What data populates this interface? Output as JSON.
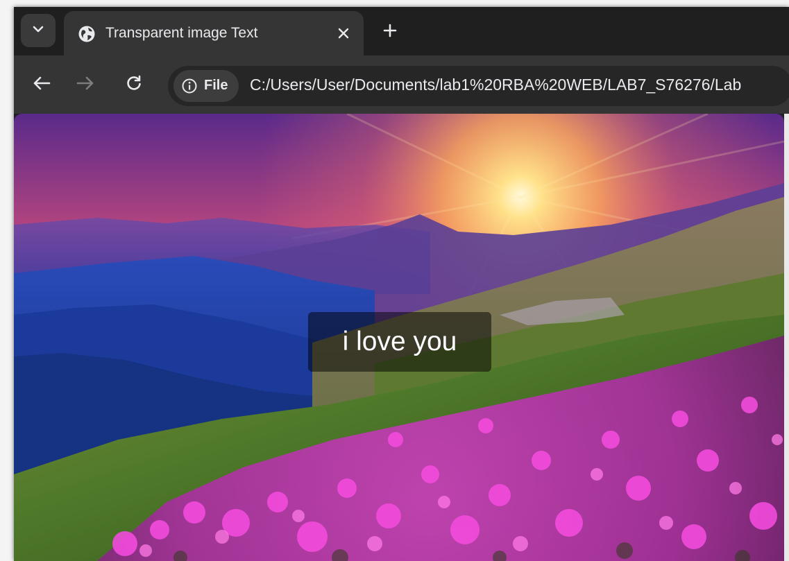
{
  "browser": {
    "tab": {
      "title": "Transparent image Text",
      "favicon": "globe-icon"
    },
    "toolbar": {
      "site_chip_label": "File",
      "url": "C:/Users/User/Documents/lab1%20RBA%20WEB/LAB7_S76276/Lab"
    },
    "colors": {
      "tabstrip": "#1f1f1f",
      "active_tab": "#353535",
      "toolbar": "#353535",
      "omnibox": "#262626",
      "text": "#e8eaed"
    }
  },
  "page": {
    "caption": "i love you",
    "background_image": "mountain sunset with pink flower meadow"
  }
}
